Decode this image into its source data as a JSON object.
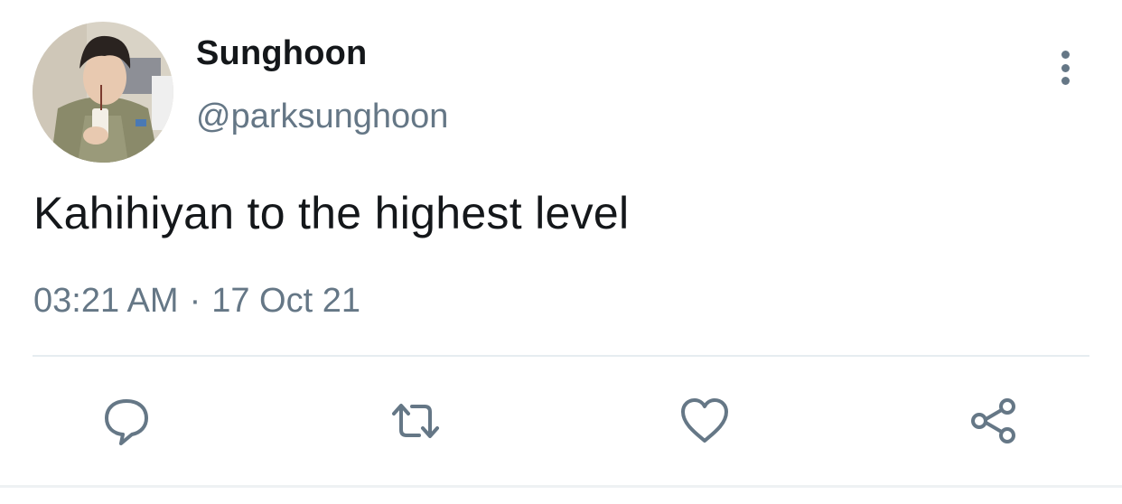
{
  "tweet": {
    "author": {
      "display_name": "Sunghoon",
      "handle": "@parksunghoon",
      "avatar": "profile-photo"
    },
    "text": "Kahihiyan to the highest level",
    "timestamp": {
      "time": "03:21 AM",
      "separator": "·",
      "date": "17 Oct 21"
    },
    "actions": [
      {
        "name": "reply",
        "icon": "speech-bubble-icon"
      },
      {
        "name": "retweet",
        "icon": "retweet-arrows-icon"
      },
      {
        "name": "like",
        "icon": "heart-icon"
      },
      {
        "name": "share",
        "icon": "share-nodes-icon"
      }
    ],
    "colors": {
      "text": "#14171a",
      "secondary": "#657786",
      "divider": "#e6ecf0"
    }
  }
}
